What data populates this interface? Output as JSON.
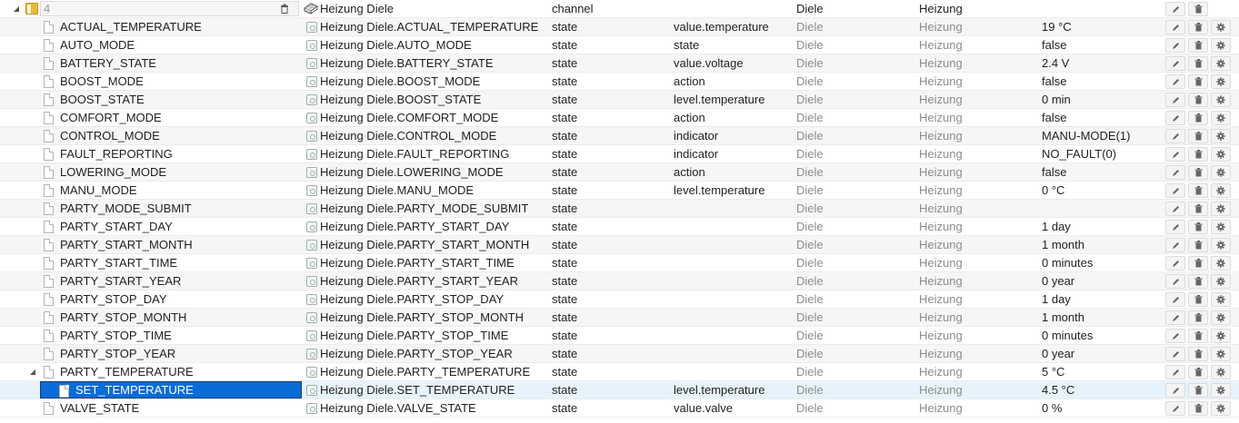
{
  "channel": {
    "id_value": "4",
    "title": "Heizung Diele",
    "type": "channel",
    "role": "",
    "room": "Diele",
    "function": "Heizung",
    "value": ""
  },
  "states": [
    {
      "name": "ACTUAL_TEMPERATURE",
      "title": "Heizung Diele.ACTUAL_TEMPERATURE",
      "type": "state",
      "role": "value.temperature",
      "room": "Diele",
      "function": "Heizung",
      "value": "19 °C"
    },
    {
      "name": "AUTO_MODE",
      "title": "Heizung Diele.AUTO_MODE",
      "type": "state",
      "role": "state",
      "room": "Diele",
      "function": "Heizung",
      "value": "false"
    },
    {
      "name": "BATTERY_STATE",
      "title": "Heizung Diele.BATTERY_STATE",
      "type": "state",
      "role": "value.voltage",
      "room": "Diele",
      "function": "Heizung",
      "value": "2.4 V"
    },
    {
      "name": "BOOST_MODE",
      "title": "Heizung Diele.BOOST_MODE",
      "type": "state",
      "role": "action",
      "room": "Diele",
      "function": "Heizung",
      "value": "false"
    },
    {
      "name": "BOOST_STATE",
      "title": "Heizung Diele.BOOST_STATE",
      "type": "state",
      "role": "level.temperature",
      "room": "Diele",
      "function": "Heizung",
      "value": "0 min"
    },
    {
      "name": "COMFORT_MODE",
      "title": "Heizung Diele.COMFORT_MODE",
      "type": "state",
      "role": "action",
      "room": "Diele",
      "function": "Heizung",
      "value": "false"
    },
    {
      "name": "CONTROL_MODE",
      "title": "Heizung Diele.CONTROL_MODE",
      "type": "state",
      "role": "indicator",
      "room": "Diele",
      "function": "Heizung",
      "value": "MANU-MODE(1)"
    },
    {
      "name": "FAULT_REPORTING",
      "title": "Heizung Diele.FAULT_REPORTING",
      "type": "state",
      "role": "indicator",
      "room": "Diele",
      "function": "Heizung",
      "value": "NO_FAULT(0)"
    },
    {
      "name": "LOWERING_MODE",
      "title": "Heizung Diele.LOWERING_MODE",
      "type": "state",
      "role": "action",
      "room": "Diele",
      "function": "Heizung",
      "value": "false"
    },
    {
      "name": "MANU_MODE",
      "title": "Heizung Diele.MANU_MODE",
      "type": "state",
      "role": "level.temperature",
      "room": "Diele",
      "function": "Heizung",
      "value": "0 °C"
    },
    {
      "name": "PARTY_MODE_SUBMIT",
      "title": "Heizung Diele.PARTY_MODE_SUBMIT",
      "type": "state",
      "role": "",
      "room": "Diele",
      "function": "Heizung",
      "value": ""
    },
    {
      "name": "PARTY_START_DAY",
      "title": "Heizung Diele.PARTY_START_DAY",
      "type": "state",
      "role": "",
      "room": "Diele",
      "function": "Heizung",
      "value": "1 day"
    },
    {
      "name": "PARTY_START_MONTH",
      "title": "Heizung Diele.PARTY_START_MONTH",
      "type": "state",
      "role": "",
      "room": "Diele",
      "function": "Heizung",
      "value": "1 month"
    },
    {
      "name": "PARTY_START_TIME",
      "title": "Heizung Diele.PARTY_START_TIME",
      "type": "state",
      "role": "",
      "room": "Diele",
      "function": "Heizung",
      "value": "0 minutes"
    },
    {
      "name": "PARTY_START_YEAR",
      "title": "Heizung Diele.PARTY_START_YEAR",
      "type": "state",
      "role": "",
      "room": "Diele",
      "function": "Heizung",
      "value": "0 year"
    },
    {
      "name": "PARTY_STOP_DAY",
      "title": "Heizung Diele.PARTY_STOP_DAY",
      "type": "state",
      "role": "",
      "room": "Diele",
      "function": "Heizung",
      "value": "1 day"
    },
    {
      "name": "PARTY_STOP_MONTH",
      "title": "Heizung Diele.PARTY_STOP_MONTH",
      "type": "state",
      "role": "",
      "room": "Diele",
      "function": "Heizung",
      "value": "1 month"
    },
    {
      "name": "PARTY_STOP_TIME",
      "title": "Heizung Diele.PARTY_STOP_TIME",
      "type": "state",
      "role": "",
      "room": "Diele",
      "function": "Heizung",
      "value": "0 minutes"
    },
    {
      "name": "PARTY_STOP_YEAR",
      "title": "Heizung Diele.PARTY_STOP_YEAR",
      "type": "state",
      "role": "",
      "room": "Diele",
      "function": "Heizung",
      "value": "0 year"
    },
    {
      "name": "PARTY_TEMPERATURE",
      "title": "Heizung Diele.PARTY_TEMPERATURE",
      "type": "state",
      "role": "",
      "room": "Diele",
      "function": "Heizung",
      "value": "5 °C"
    },
    {
      "name": "SET_TEMPERATURE",
      "title": "Heizung Diele.SET_TEMPERATURE",
      "type": "state",
      "role": "level.temperature",
      "room": "Diele",
      "function": "Heizung",
      "value": "4.5 °C"
    },
    {
      "name": "VALVE_STATE",
      "title": "Heizung Diele.VALVE_STATE",
      "type": "state",
      "role": "value.valve",
      "room": "Diele",
      "function": "Heizung",
      "value": "0 %"
    }
  ],
  "selected_index": 20,
  "expanded_index": 19,
  "colors": {
    "selection": "#0a6cd6",
    "highlight_row": "#e6f3fc",
    "folder": "#e8b93e",
    "muted_text": "#8c8c8c"
  },
  "icons": {
    "expand": "triangle-expanded-icon",
    "folder": "folder-icon",
    "file": "file-icon",
    "object": "state-object-icon",
    "channel": "channel-icon",
    "edit": "pencil-icon",
    "delete": "trash-icon",
    "settings": "gear-icon"
  }
}
